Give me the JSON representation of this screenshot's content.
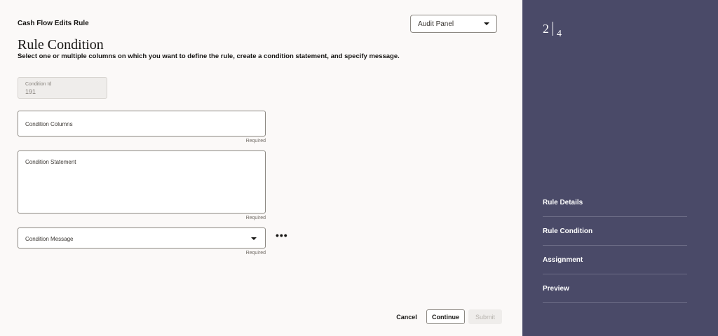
{
  "header": {
    "app_title": "Cash Flow Edits Rule",
    "audit_select": "Audit Panel"
  },
  "page": {
    "title": "Rule Condition",
    "description": "Select one or multiple columns on which you want to define the rule, create a condition statement, and specify message."
  },
  "form": {
    "condition_id": {
      "label": "Condition Id",
      "value": "191"
    },
    "condition_columns": {
      "label": "Condition Columns",
      "hint": "Required"
    },
    "condition_statement": {
      "label": "Condition Statement",
      "hint": "Required"
    },
    "condition_message": {
      "label": "Condition Message",
      "hint": "Required"
    },
    "more": "•••"
  },
  "actions": {
    "cancel": "Cancel",
    "continue": "Continue",
    "submit": "Submit"
  },
  "train": {
    "current": "2",
    "total": "4",
    "steps": [
      "Rule Details",
      "Rule Condition",
      "Assignment",
      "Preview"
    ],
    "active_index": 1
  },
  "colors": {
    "sidebar": "#4a4a68",
    "main_bg": "#fbf9f8"
  }
}
